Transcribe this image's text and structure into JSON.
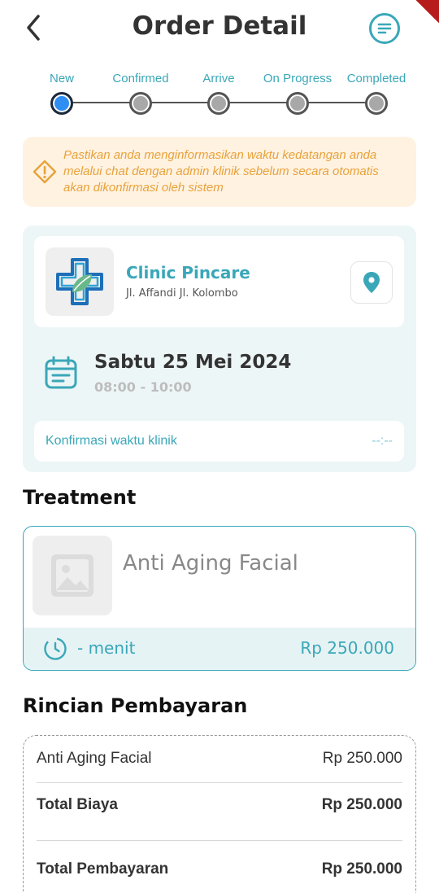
{
  "header": {
    "title": "Order Detail"
  },
  "stepper": {
    "steps": [
      {
        "label": "New",
        "active": true
      },
      {
        "label": "Confirmed",
        "active": false
      },
      {
        "label": "Arrive",
        "active": false
      },
      {
        "label": "On Progress",
        "active": false
      },
      {
        "label": "Completed",
        "active": false
      }
    ]
  },
  "warning": {
    "text": "Pastikan anda menginformasikan waktu kedatangan anda melalui chat dengan admin klinik sebelum secara otomatis akan dikonfirmasi oleh sistem"
  },
  "clinic": {
    "name": "Clinic Pincare",
    "address": "Jl. Affandi Jl. Kolombo"
  },
  "schedule": {
    "date": "Sabtu 25 Mei 2024",
    "time": "08:00 - 10:00",
    "confirm_label": "Konfirmasi waktu klinik",
    "confirm_value": "--:--"
  },
  "treatment": {
    "section_title": "Treatment",
    "name": "Anti Aging Facial",
    "duration": "-  menit",
    "price": "Rp 250.000"
  },
  "payment": {
    "section_title": "Rincian Pembayaran",
    "items": [
      {
        "label": "Anti Aging Facial",
        "value": "Rp 250.000"
      }
    ],
    "total_cost_label": "Total Biaya",
    "total_cost_value": "Rp 250.000",
    "total_payment_label": "Total Pembayaran",
    "total_payment_value": "Rp 250.000"
  },
  "colors": {
    "accent": "#3aa7b8",
    "active_step": "#2f8ef2",
    "warning_bg": "#fff2e1",
    "warning_text": "#e8a23b"
  }
}
